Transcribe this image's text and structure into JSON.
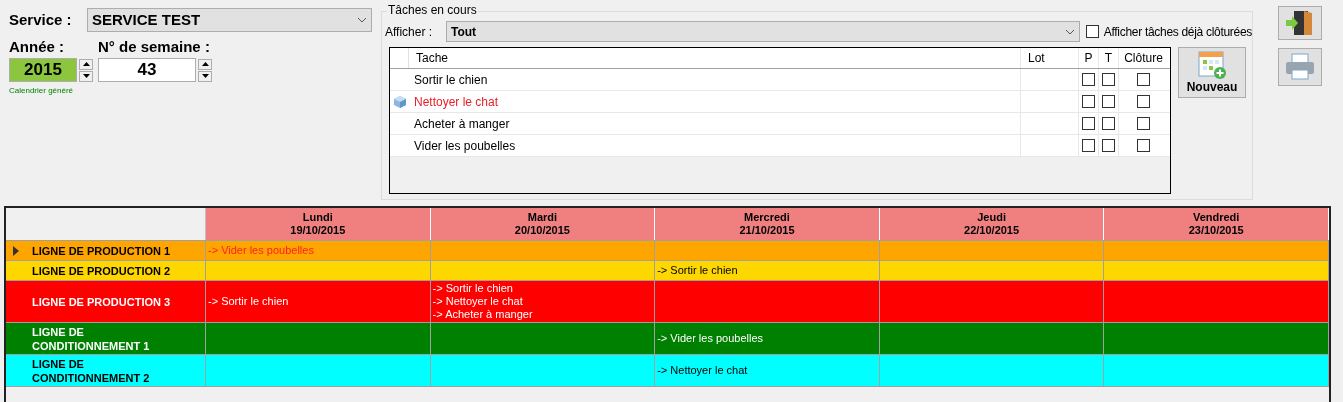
{
  "service": {
    "label": "Service :",
    "value": "SERVICE TEST"
  },
  "year": {
    "label": "Année :",
    "value": "2015",
    "generated": true,
    "status": "Calendrier généré"
  },
  "week": {
    "label": "N° de semaine :",
    "value": "43"
  },
  "tasks_panel": {
    "title": "Tâches en cours",
    "filter_label": "Afficher :",
    "filter_value": "Tout",
    "show_closed": {
      "label": "Afficher tâches déjà clôturées",
      "checked": false
    },
    "columns": [
      "Tache",
      "Lot",
      "P",
      "T",
      "Clôture"
    ],
    "rows": [
      {
        "task": "Sortir le chien",
        "flagged": false,
        "p": false,
        "t": false,
        "closed": false
      },
      {
        "task": "Nettoyer le chat",
        "flagged": true,
        "p": false,
        "t": false,
        "closed": false
      },
      {
        "task": "Acheter à manger",
        "flagged": false,
        "p": false,
        "t": false,
        "closed": false
      },
      {
        "task": "Vider les poubelles",
        "flagged": false,
        "p": false,
        "t": false,
        "closed": false
      }
    ],
    "new_button": "Nouveau"
  },
  "schedule": {
    "days": [
      {
        "day": "Lundi",
        "date": "19/10/2015"
      },
      {
        "day": "Mardi",
        "date": "20/10/2015"
      },
      {
        "day": "Mercredi",
        "date": "21/10/2015"
      },
      {
        "day": "Jeudi",
        "date": "22/10/2015"
      },
      {
        "day": "Vendredi",
        "date": "23/10/2015"
      }
    ],
    "rows": [
      {
        "label": "LIGNE DE PRODUCTION 1",
        "color": "#ffa500",
        "selected": true,
        "cells": [
          [
            {
              "text": "-> Vider les poubelles",
              "late": true
            }
          ],
          [],
          [],
          [],
          []
        ]
      },
      {
        "label": "LIGNE DE PRODUCTION 2",
        "color": "#ffd700",
        "selected": false,
        "cells": [
          [],
          [],
          [
            {
              "text": "-> Sortir le chien",
              "late": false
            }
          ],
          [],
          []
        ]
      },
      {
        "label": "LIGNE DE PRODUCTION 3",
        "color": "#ff0000",
        "selected": false,
        "cells": [
          [
            {
              "text": "-> Sortir le chien",
              "late": false
            }
          ],
          [
            {
              "text": "-> Sortir le chien",
              "late": false
            },
            {
              "text": "-> Nettoyer le chat",
              "late": false
            },
            {
              "text": "-> Acheter à manger",
              "late": false
            }
          ],
          [],
          [],
          []
        ]
      },
      {
        "label": "LIGNE DE CONDITIONNEMENT 1",
        "color": "#008000",
        "selected": false,
        "cells": [
          [],
          [],
          [
            {
              "text": "-> Vider les poubelles",
              "late": false
            }
          ],
          [],
          []
        ]
      },
      {
        "label": "LIGNE DE CONDITIONNEMENT 2",
        "color": "#00ffff",
        "selected": false,
        "cells": [
          [],
          [],
          [
            {
              "text": "-> Nettoyer le chat",
              "late": false
            }
          ],
          [],
          []
        ]
      }
    ]
  }
}
